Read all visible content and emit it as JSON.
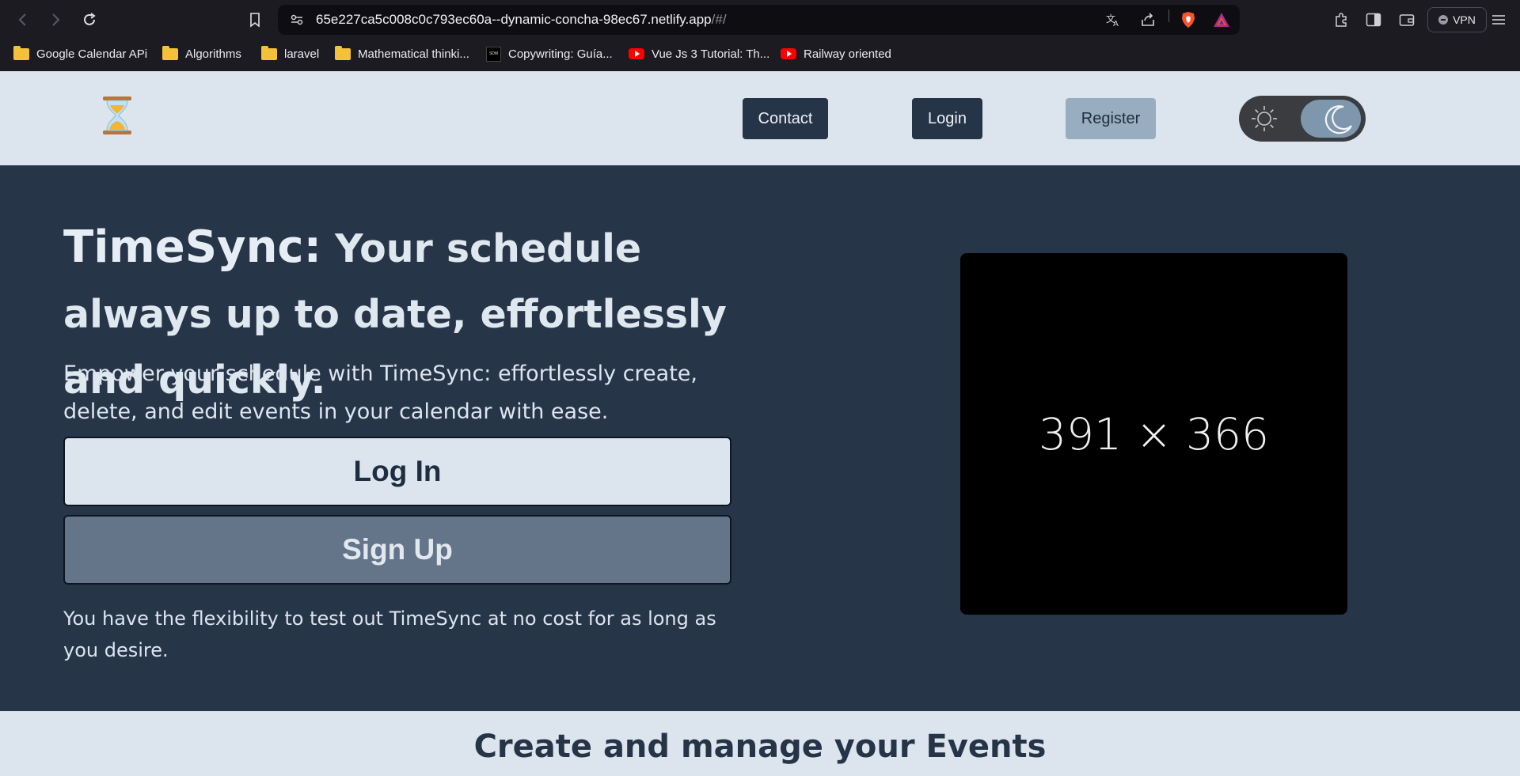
{
  "browser": {
    "url_main": "65e227ca5c008c0c793ec60a--dynamic-concha-98ec67.netlify.app",
    "url_rest": "/#/",
    "vpn_label": "VPN",
    "bookmarks": [
      {
        "label": "Google Calendar APi",
        "icon": "folder-icon"
      },
      {
        "label": "Algorithms",
        "icon": "folder-icon"
      },
      {
        "label": "laravel",
        "icon": "folder-icon"
      },
      {
        "label": "Mathematical thinki...",
        "icon": "folder-icon"
      },
      {
        "label": "Copywriting: Guía...",
        "icon": "site-favicon-icon"
      },
      {
        "label": "Vue Js 3 Tutorial: Th...",
        "icon": "youtube-icon"
      },
      {
        "label": "Railway oriented",
        "icon": "youtube-icon"
      }
    ]
  },
  "header": {
    "logo": "hourglass-icon",
    "nav": {
      "contact": "Contact",
      "login": "Login",
      "register": "Register"
    },
    "theme_toggle": {
      "state": "dark",
      "icons": [
        "sun-icon",
        "moon-icon"
      ]
    }
  },
  "hero": {
    "brand": "TimeSync:",
    "headline": " Your schedule always up to date, effortlessly and quickly.",
    "subtext": "Empower your schedule with TimeSync: effortlessly create, delete, and edit events in your calendar with ease.",
    "login_button": "Log In",
    "signup_button": "Sign Up",
    "free_text": "You have the flexibility to test out TimeSync at no cost for as long as you desire.",
    "image_placeholder": "391 × 366"
  },
  "features": {
    "title": "Create and manage your Events"
  },
  "colors": {
    "header_bg": "#dce5ee",
    "hero_bg": "#273549",
    "button_dark": "#263447",
    "button_light": "#98adbf",
    "signup_bg": "#64758a"
  }
}
